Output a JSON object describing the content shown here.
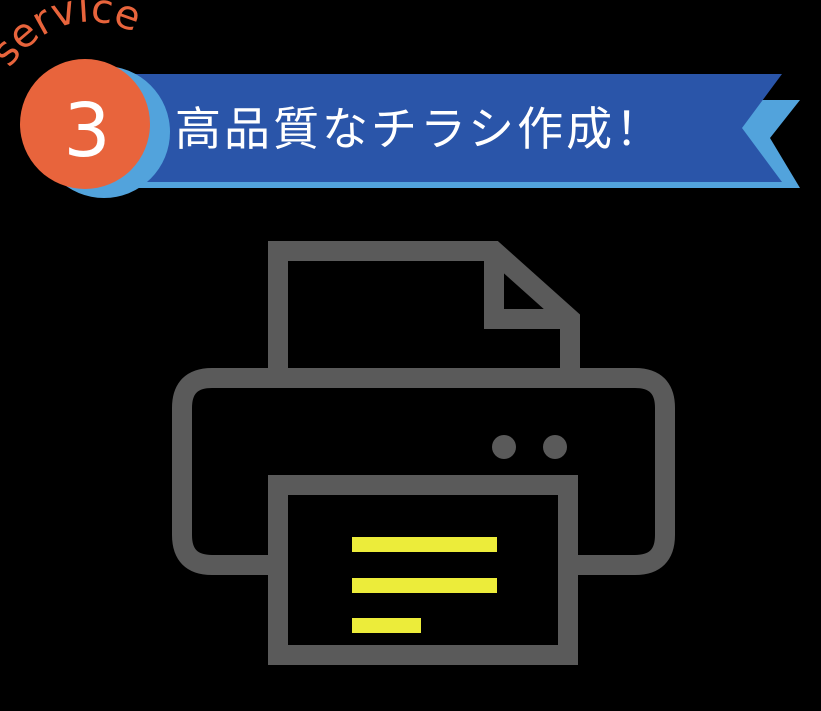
{
  "badge": {
    "arc_text": "service",
    "number": "3"
  },
  "banner": {
    "title": "高品質なチラシ作成！"
  },
  "colors": {
    "background": "#000000",
    "banner_blue": "#2a55a9",
    "banner_light_blue": "#52a3dc",
    "badge_orange": "#e8643c",
    "printer_gray": "#5a5a5a",
    "paper_lines_yellow": "#ecec3a"
  },
  "icons": {
    "main": "printer-icon"
  }
}
